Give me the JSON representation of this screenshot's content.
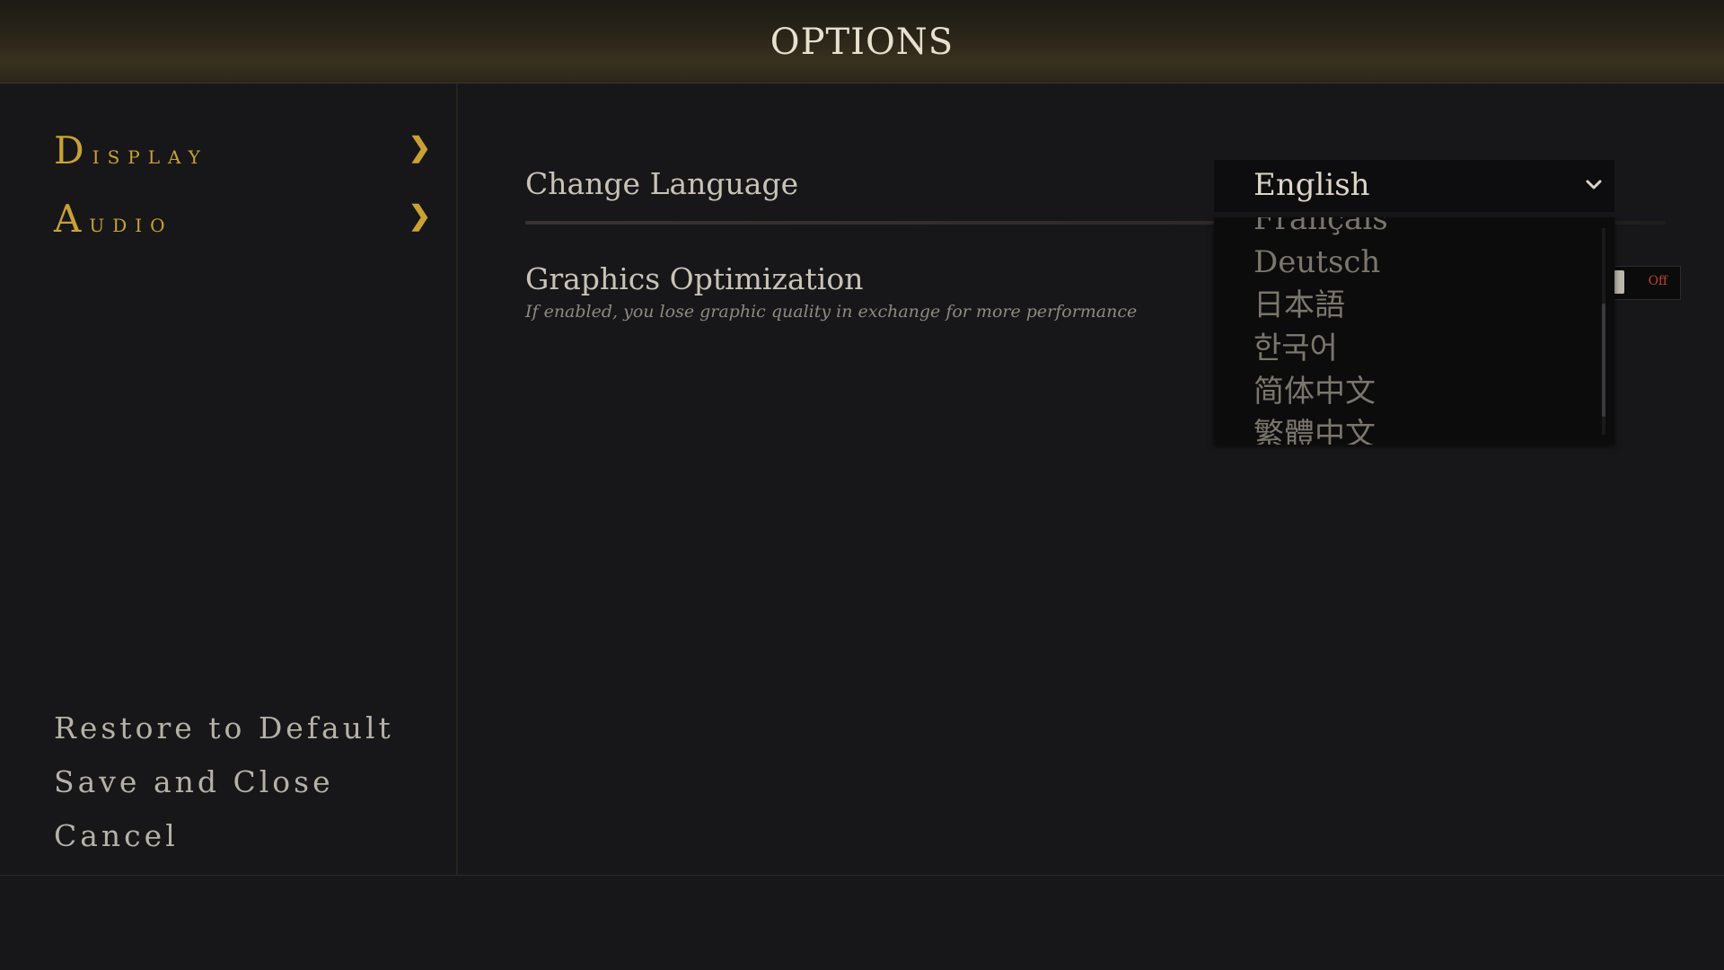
{
  "header": {
    "title": "OPTIONS"
  },
  "sidebar": {
    "items": [
      {
        "label": "Display",
        "chevron": "❯"
      },
      {
        "label": "Audio",
        "chevron": "❯"
      }
    ],
    "actions": {
      "restore": "Restore to Default",
      "save_close": "Save and Close",
      "cancel": "Cancel"
    }
  },
  "settings": {
    "language": {
      "label": "Change Language",
      "selected": "English",
      "options": [
        "Français",
        "Deutsch",
        "日本語",
        "한국어",
        "简体中文",
        "繁體中文"
      ]
    },
    "graphics": {
      "label": "Graphics Optimization",
      "description": "If enabled, you lose graphic quality in exchange for more performance",
      "toggle_state": "Off"
    }
  },
  "colors": {
    "accent_gold": "#c9a233",
    "background": "#17171a",
    "toggle_off_red": "#b8462f"
  },
  "icons": {
    "nav_chevron": "chevron-right-icon",
    "select_chevron": "chevron-down-icon"
  }
}
